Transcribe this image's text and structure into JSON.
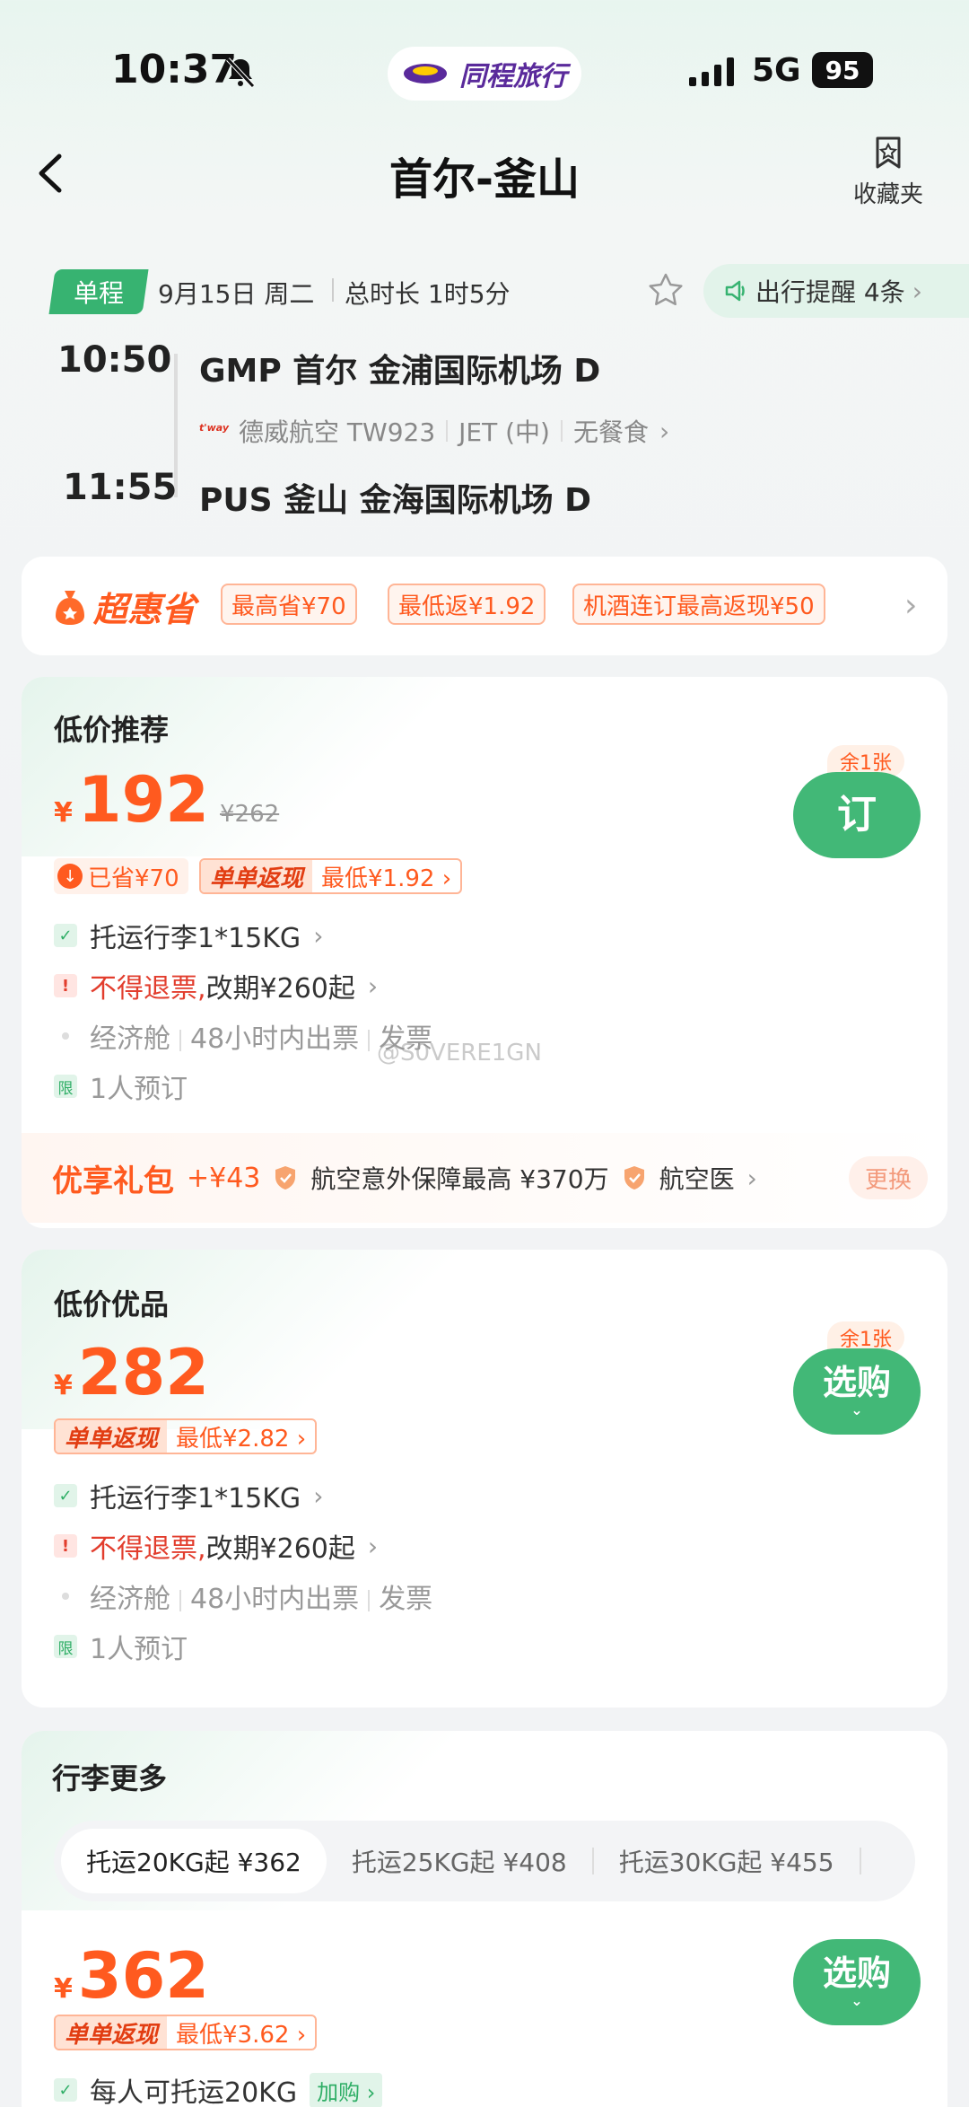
{
  "status": {
    "time": "10:37",
    "network": "5G",
    "battery": "95",
    "app_name": "同程旅行"
  },
  "nav": {
    "title": "首尔-釜山",
    "favorites_label": "收藏夹"
  },
  "flight": {
    "trip_type": "单程",
    "date": "9月15日 周二",
    "duration": "总时长 1时5分",
    "reminder": "出行提醒 4条",
    "dep_time": "10:50",
    "arr_time": "11:55",
    "dep_airport": "GMP 首尔 金浦国际机场 D",
    "arr_airport": "PUS 釜山 金海国际机场 D",
    "airline_logo_text": "t'way",
    "airline": "德威航空 TW923",
    "aircraft": "JET (中)",
    "meal": "无餐食"
  },
  "savings": {
    "brand": "超惠省",
    "tags": [
      "最高省¥70",
      "最低返¥1.92",
      "机酒连订最高返现¥50"
    ]
  },
  "cards": [
    {
      "title": "低价推荐",
      "currency": "¥",
      "price": "192",
      "old_price": "¥262",
      "saved": "已省¥70",
      "cashback_label": "单单返现",
      "cashback_value": "最低¥1.92",
      "baggage": "托运行李1*15KG",
      "refund_warn": "不得退票,",
      "refund_change": "改期¥260起",
      "cabin": "经济舱",
      "ticketing": "48小时内出票",
      "invoice": "发票",
      "limit_icon": "限",
      "limit": "1人预订",
      "remaining": "余1张",
      "button": "订",
      "gift": {
        "title": "优享礼包",
        "plus": "+¥43",
        "item1": "航空意外保障最高 ¥370万",
        "item2": "航空医",
        "swap": "更换"
      }
    },
    {
      "title": "低价优品",
      "currency": "¥",
      "price": "282",
      "cashback_label": "单单返现",
      "cashback_value": "最低¥2.82",
      "baggage": "托运行李1*15KG",
      "refund_warn": "不得退票,",
      "refund_change": "改期¥260起",
      "cabin": "经济舱",
      "ticketing": "48小时内出票",
      "invoice": "发票",
      "limit_icon": "限",
      "limit": "1人预订",
      "remaining": "余1张",
      "button": "选购"
    },
    {
      "title": "行李更多",
      "tabs": [
        "托运20KG起 ¥362",
        "托运25KG起 ¥408",
        "托运30KG起 ¥455"
      ],
      "currency": "¥",
      "price": "362",
      "cashback_label": "单单返现",
      "cashback_value": "最低¥3.62",
      "baggage": "每人可托运20KG",
      "add_on": "加购",
      "button": "选购"
    }
  ],
  "watermark": "@S0VERE1GN"
}
